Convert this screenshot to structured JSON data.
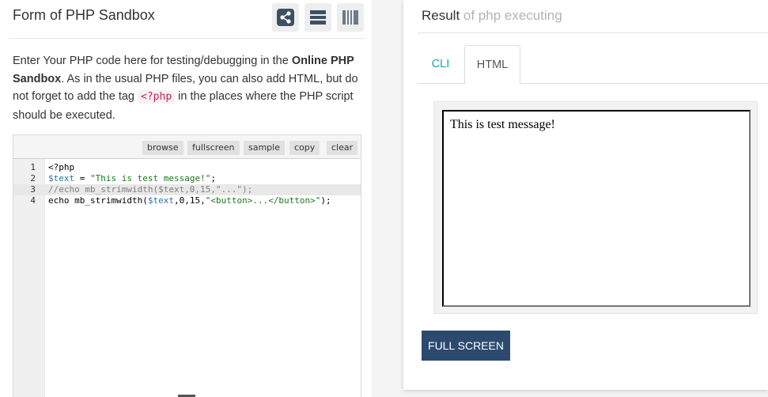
{
  "left_panel": {
    "title": "Form of PHP Sandbox",
    "header_buttons": [
      {
        "icon": "share-icon"
      },
      {
        "icon": "rows-layout-icon"
      },
      {
        "icon": "columns-layout-icon"
      }
    ],
    "description": {
      "part1": "Enter Your PHP code here for testing/debugging in the ",
      "bold": "Online PHP Sandbox",
      "part2": ". As in the usual PHP files, you can also add HTML, but do not forget to add the tag ",
      "code_tag": "<?php",
      "part3": " in the places where the PHP script should be executed."
    },
    "toolbar": {
      "browse": "browse",
      "fullscreen": "fullscreen",
      "sample": "sample",
      "copy": "copy",
      "clear": "clear"
    },
    "code_lines": [
      {
        "num": "1",
        "segments": [
          {
            "t": "<?php",
            "c": "kw"
          }
        ]
      },
      {
        "num": "2",
        "segments": [
          {
            "t": "$text",
            "c": "var"
          },
          {
            "t": " = ",
            "c": "kw"
          },
          {
            "t": "\"This is test message!\"",
            "c": "str"
          },
          {
            "t": ";",
            "c": "kw"
          }
        ]
      },
      {
        "num": "3",
        "segments": [
          {
            "t": "//echo mb_strimwidth($text,0,15,\"...\");",
            "c": "cm"
          }
        ],
        "active": true
      },
      {
        "num": "4",
        "segments": [
          {
            "t": "echo mb_strimwidth(",
            "c": "kw"
          },
          {
            "t": "$text",
            "c": "var"
          },
          {
            "t": ",0,15,",
            "c": "kw"
          },
          {
            "t": "\"<button>...</button>\"",
            "c": "str"
          },
          {
            "t": ");",
            "c": "kw"
          }
        ]
      }
    ]
  },
  "right_panel": {
    "title_main": "Result",
    "title_sub": " of php executing",
    "tabs": {
      "cli": "CLI",
      "html": "HTML"
    },
    "output_text": "This is test message!",
    "fullscreen_button": "FULL SCREEN"
  },
  "colors": {
    "accent_cli": "#17a2b8",
    "fullscreen_button": "#2c4a6e",
    "code_tag": "#c7254e"
  }
}
